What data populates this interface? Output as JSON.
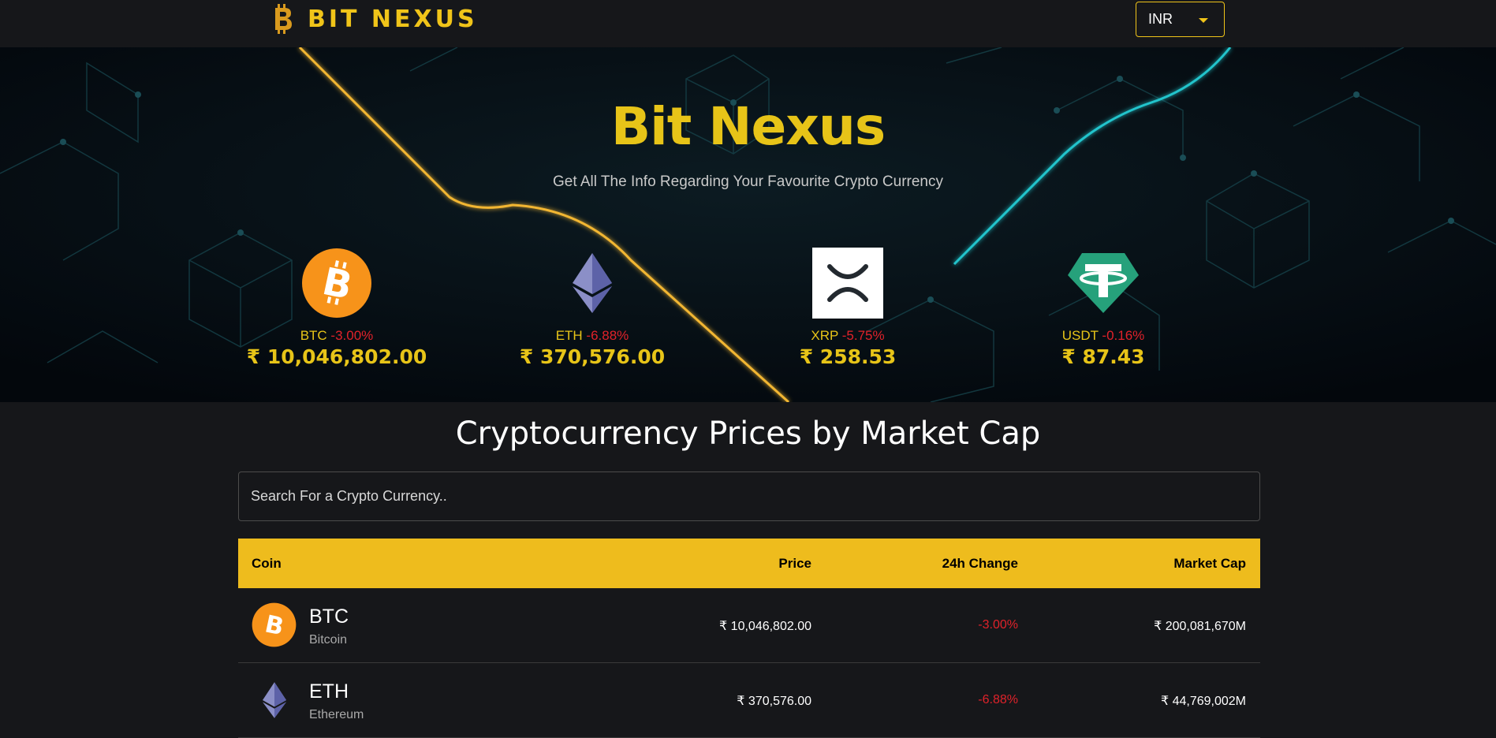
{
  "header": {
    "brand": "BIT NEXUS",
    "currency": "INR",
    "colors": {
      "accent": "#f0c419",
      "background": "#16171a"
    }
  },
  "hero": {
    "title": "Bit Nexus",
    "subtitle": "Get All The Info Regarding Your Favourite Crypto Currency",
    "coins": [
      {
        "symbol": "BTC",
        "change": "-3.00%",
        "price": "₹ 10,046,802.00",
        "icon": "bitcoin-icon"
      },
      {
        "symbol": "ETH",
        "change": "-6.88%",
        "price": "₹ 370,576.00",
        "icon": "ethereum-icon"
      },
      {
        "symbol": "XRP",
        "change": "-5.75%",
        "price": "₹ 258.53",
        "icon": "xrp-icon"
      },
      {
        "symbol": "USDT",
        "change": "-0.16%",
        "price": "₹ 87.43",
        "icon": "tether-icon"
      }
    ]
  },
  "main": {
    "title": "Cryptocurrency Prices by Market Cap",
    "search_placeholder": "Search For a Crypto Currency..",
    "table": {
      "headers": {
        "coin": "Coin",
        "price": "Price",
        "change": "24h Change",
        "cap": "Market Cap"
      },
      "rows": [
        {
          "symbol": "BTC",
          "name": "Bitcoin",
          "price": "₹ 10,046,802.00",
          "change": "-3.00%",
          "cap": "₹ 200,081,670M",
          "icon": "bitcoin-icon"
        },
        {
          "symbol": "ETH",
          "name": "Ethereum",
          "price": "₹ 370,576.00",
          "change": "-6.88%",
          "cap": "₹ 44,769,002M",
          "icon": "ethereum-icon"
        }
      ]
    }
  }
}
